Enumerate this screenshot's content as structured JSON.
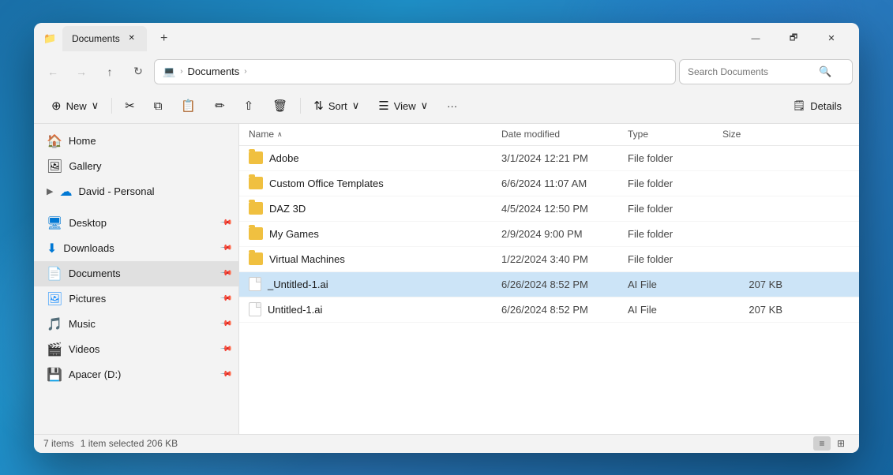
{
  "window": {
    "title": "Documents",
    "tab_icon": "📁",
    "tab_close": "✕",
    "tab_add": "+",
    "min": "—",
    "max": "🗗",
    "close": "✕"
  },
  "navbar": {
    "back": "←",
    "forward": "→",
    "up": "↑",
    "refresh": "↻",
    "computer_icon": "💻",
    "chevron1": "›",
    "address": "Documents",
    "chevron2": "›",
    "search_placeholder": "Search Documents",
    "search_icon": "🔍"
  },
  "toolbar": {
    "new_label": "New",
    "new_icon": "⊕",
    "new_chevron": "∨",
    "cut_icon": "✂",
    "copy_icon": "⧉",
    "paste_icon": "📋",
    "rename_icon": "✏",
    "share_icon": "⇧",
    "delete_icon": "🗑",
    "sort_label": "Sort",
    "sort_icon": "⇅",
    "sort_chevron": "∨",
    "view_label": "View",
    "view_icon": "☰",
    "view_chevron": "∨",
    "more_icon": "···",
    "details_icon": "🗒",
    "details_label": "Details"
  },
  "file_header": {
    "name": "Name",
    "name_sort": "∧",
    "date": "Date modified",
    "type": "Type",
    "size": "Size"
  },
  "files": [
    {
      "name": "Adobe",
      "icon": "folder",
      "date": "3/1/2024 12:21 PM",
      "type": "File folder",
      "size": ""
    },
    {
      "name": "Custom Office Templates",
      "icon": "folder",
      "date": "6/6/2024 11:07 AM",
      "type": "File folder",
      "size": ""
    },
    {
      "name": "DAZ 3D",
      "icon": "folder",
      "date": "4/5/2024 12:50 PM",
      "type": "File folder",
      "size": ""
    },
    {
      "name": "My Games",
      "icon": "folder",
      "date": "2/9/2024 9:00 PM",
      "type": "File folder",
      "size": ""
    },
    {
      "name": "Virtual Machines",
      "icon": "folder",
      "date": "1/22/2024 3:40 PM",
      "type": "File folder",
      "size": ""
    },
    {
      "name": "_Untitled-1.ai",
      "icon": "file",
      "date": "6/26/2024 8:52 PM",
      "type": "AI File",
      "size": "207 KB",
      "selected": true
    },
    {
      "name": "Untitled-1.ai",
      "icon": "file",
      "date": "6/26/2024 8:52 PM",
      "type": "AI File",
      "size": "207 KB"
    }
  ],
  "sidebar": {
    "items": [
      {
        "id": "home",
        "label": "Home",
        "icon": "home",
        "pinned": false,
        "indent": 0
      },
      {
        "id": "gallery",
        "label": "Gallery",
        "icon": "gallery",
        "pinned": false,
        "indent": 0
      },
      {
        "id": "david",
        "label": "David - Personal",
        "icon": "cloud",
        "pinned": false,
        "indent": 0,
        "expandable": true
      },
      {
        "id": "desktop",
        "label": "Desktop",
        "icon": "desktop",
        "pinned": true,
        "indent": 0
      },
      {
        "id": "downloads",
        "label": "Downloads",
        "icon": "downloads",
        "pinned": true,
        "indent": 0
      },
      {
        "id": "documents",
        "label": "Documents",
        "icon": "documents",
        "pinned": true,
        "indent": 0,
        "active": true
      },
      {
        "id": "pictures",
        "label": "Pictures",
        "icon": "pictures",
        "pinned": true,
        "indent": 0
      },
      {
        "id": "music",
        "label": "Music",
        "icon": "music",
        "pinned": true,
        "indent": 0
      },
      {
        "id": "videos",
        "label": "Videos",
        "icon": "videos",
        "pinned": true,
        "indent": 0
      },
      {
        "id": "apacer",
        "label": "Apacer (D:)",
        "icon": "drive",
        "pinned": true,
        "indent": 0
      }
    ]
  },
  "statusbar": {
    "items_count": "7 items",
    "selected_info": "1 item selected  206 KB"
  },
  "colors": {
    "selected_row_bg": "#cce4f7",
    "folder_color": "#f0c040"
  }
}
